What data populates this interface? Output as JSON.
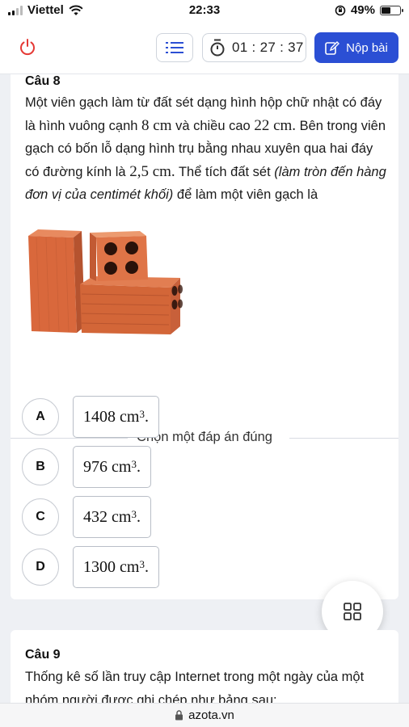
{
  "status_bar": {
    "carrier": "Viettel",
    "time": "22:33",
    "battery": "49%",
    "battery_level": 0.49
  },
  "toolbar": {
    "timer": "01 : 27 : 37",
    "submit_label": "Nộp bài"
  },
  "question8": {
    "number": "Câu 8",
    "text_parts": [
      "Một viên gạch làm từ đất sét dạng hình hộp chữ nhật có đáy là hình vuông cạnh ",
      "8",
      " cm",
      " và chiều cao ",
      "22",
      " cm.",
      " Bên trong viên gạch có bốn lỗ dạng hình trụ bằng nhau xuyên qua hai đáy có đường kính là ",
      "2,5",
      " cm.",
      " Thể tích đất sét ",
      "(làm tròn đến hàng đơn vị của centimét khối)",
      " để làm một viên gạch là"
    ],
    "choose_label": "Chọn một đáp án đúng",
    "options": [
      {
        "letter": "A",
        "value": "1408",
        "unit": "cm",
        "exp": "3",
        "end": "."
      },
      {
        "letter": "B",
        "value": "976",
        "unit": "cm",
        "exp": "3",
        "end": "."
      },
      {
        "letter": "C",
        "value": "432",
        "unit": "cm",
        "exp": "3",
        "end": "."
      },
      {
        "letter": "D",
        "value": "1300",
        "unit": "cm",
        "exp": "3",
        "end": "."
      }
    ]
  },
  "question9": {
    "number": "Câu 9",
    "text": "Thống kê số lần truy cập Internet trong một ngày của một nhóm người được ghi chép như bảng sau:"
  },
  "browser": {
    "domain": "azota.vn"
  },
  "colors": {
    "accent": "#2b4fd4",
    "power_icon": "#e53935",
    "brick": "#d9683c"
  }
}
